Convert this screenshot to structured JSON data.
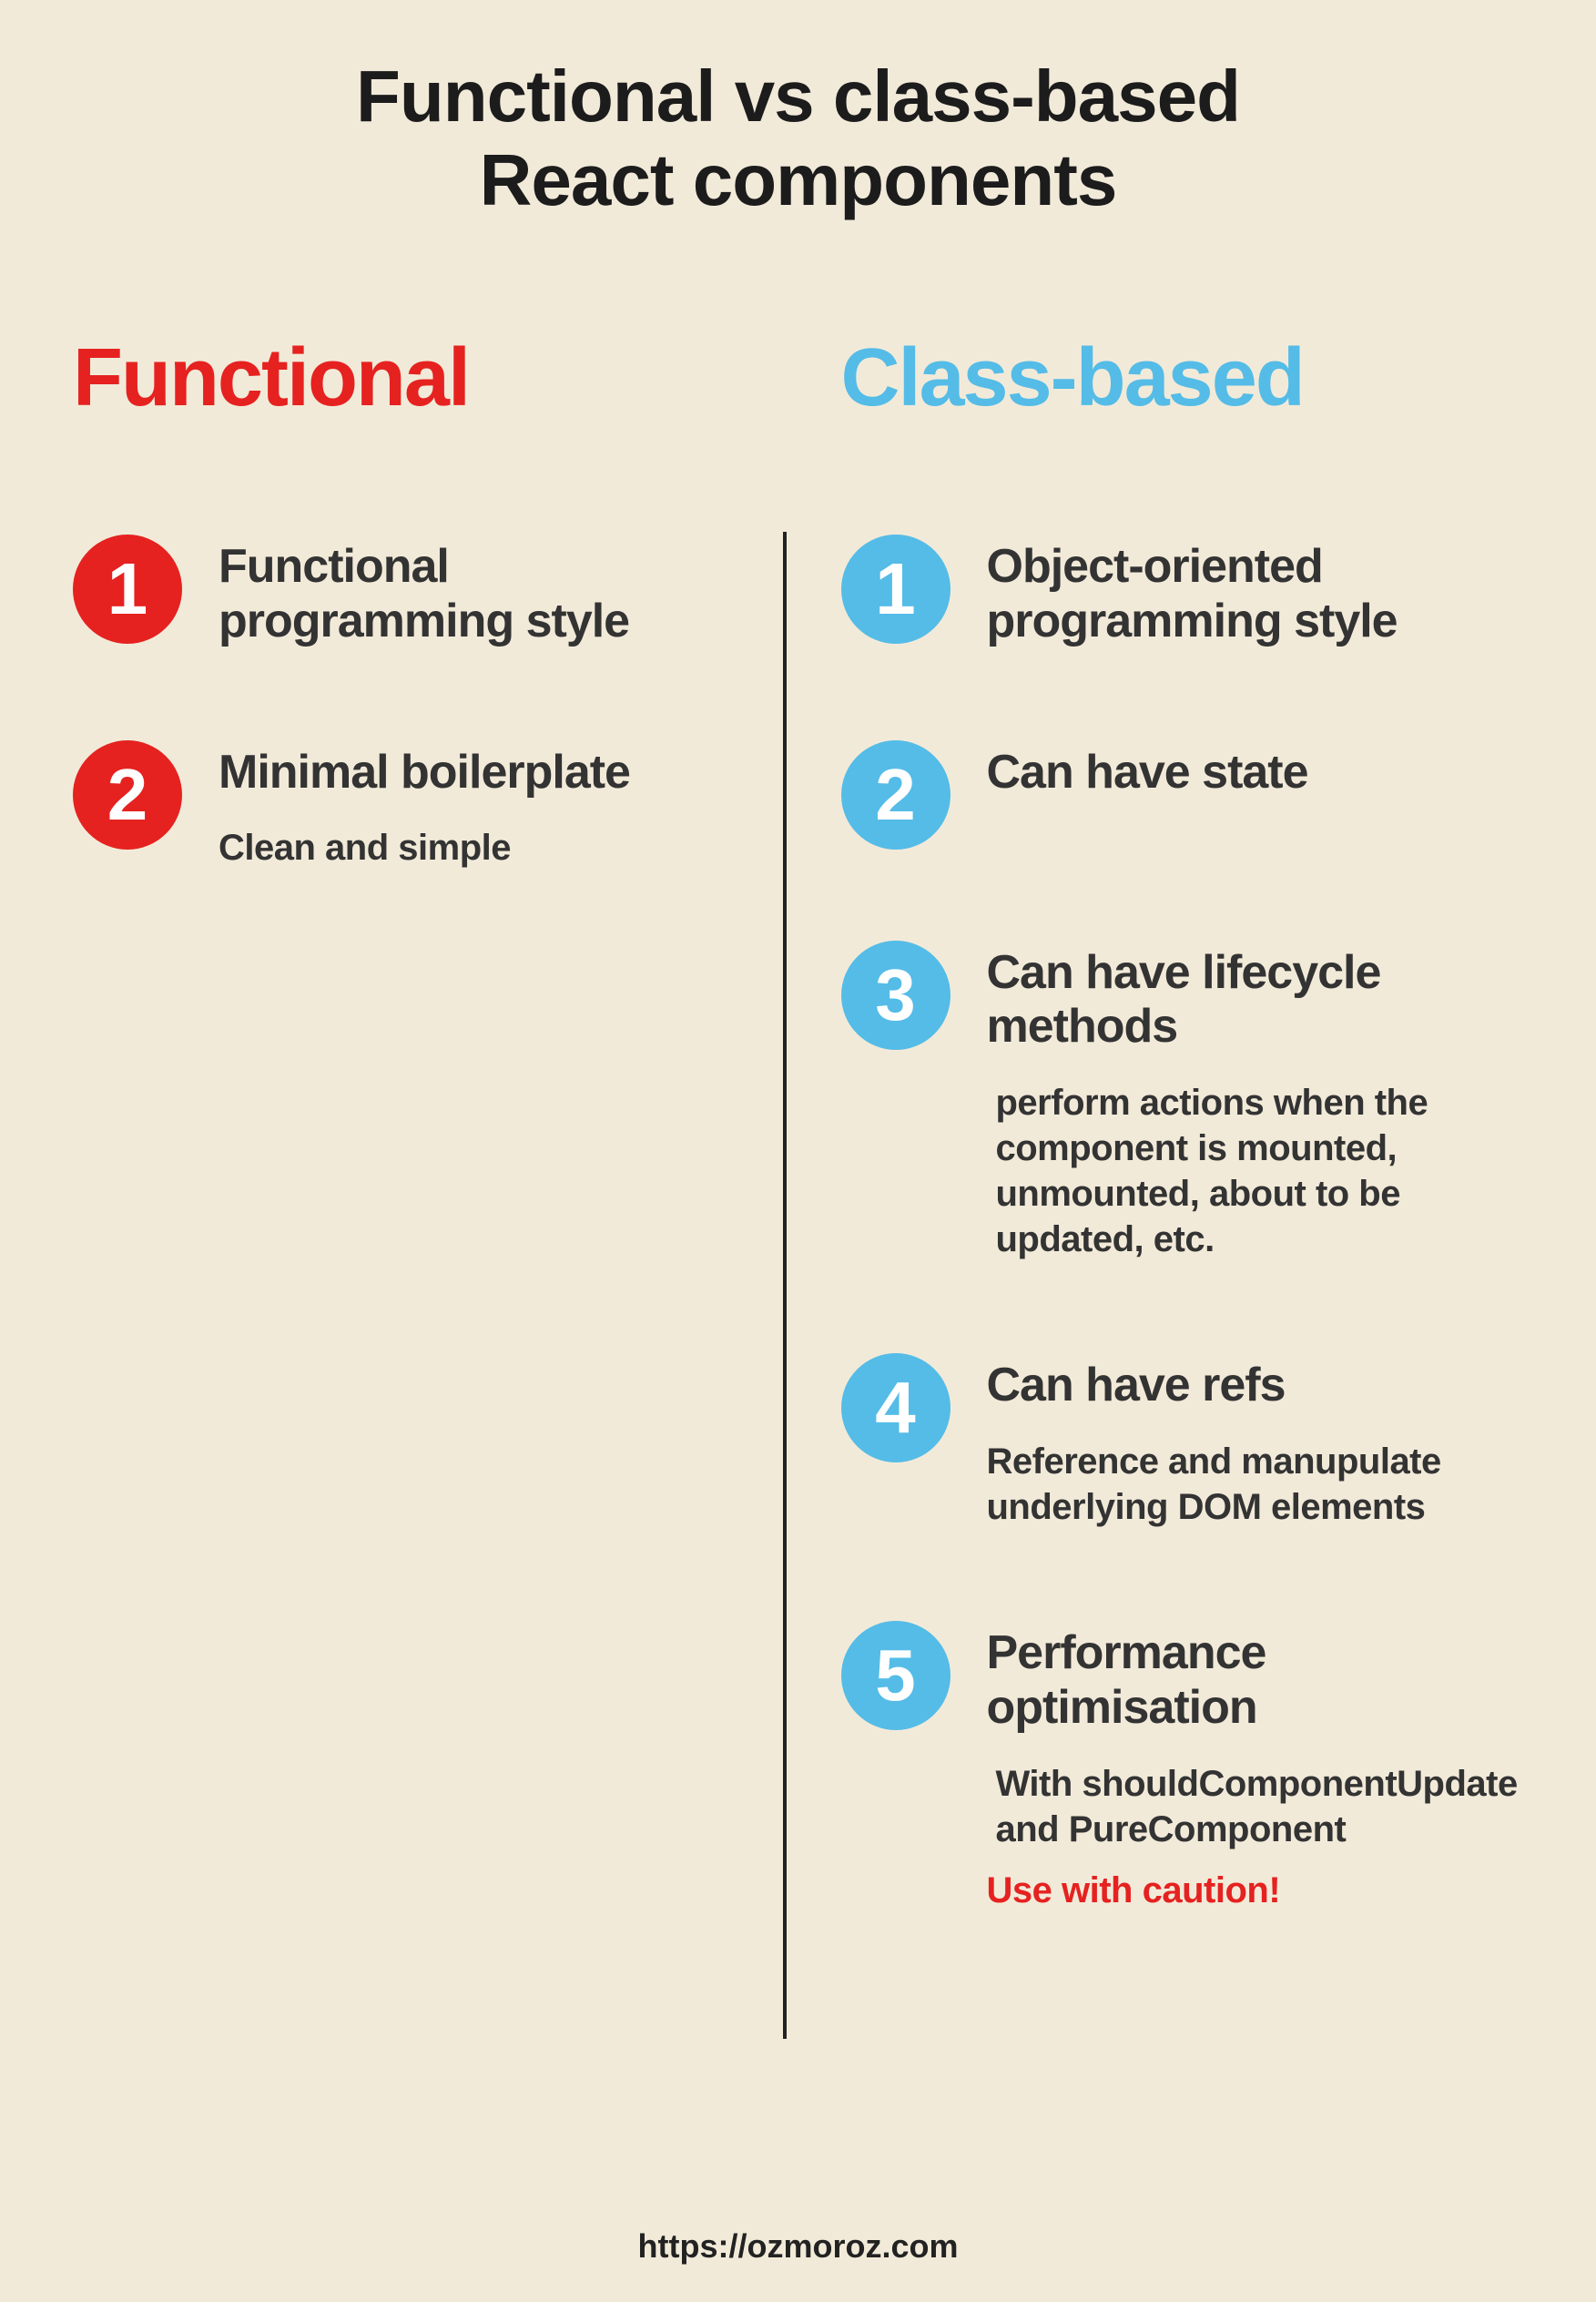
{
  "title_line1": "Functional vs class-based",
  "title_line2": "React components",
  "left": {
    "header": "Functional",
    "items": [
      {
        "num": "1",
        "title": "Functional programming style",
        "sub": ""
      },
      {
        "num": "2",
        "title": "Minimal boilerplate",
        "sub": "Clean and simple"
      }
    ]
  },
  "right": {
    "header": "Class-based",
    "items": [
      {
        "num": "1",
        "title": "Object-oriented programming style",
        "sub": ""
      },
      {
        "num": "2",
        "title": "Can have state",
        "sub": ""
      },
      {
        "num": "3",
        "title": "Can have lifecycle methods",
        "sub": "perform actions when the component is mounted, unmounted, about to be updated, etc."
      },
      {
        "num": "4",
        "title": "Can have refs",
        "sub": "Reference and manupulate underlying DOM elements"
      },
      {
        "num": "5",
        "title": "Performance optimisation",
        "sub": "With shouldComponentUpdate and PureComponent",
        "caution": "Use with caution!"
      }
    ]
  },
  "footer": "https://ozmoroz.com"
}
